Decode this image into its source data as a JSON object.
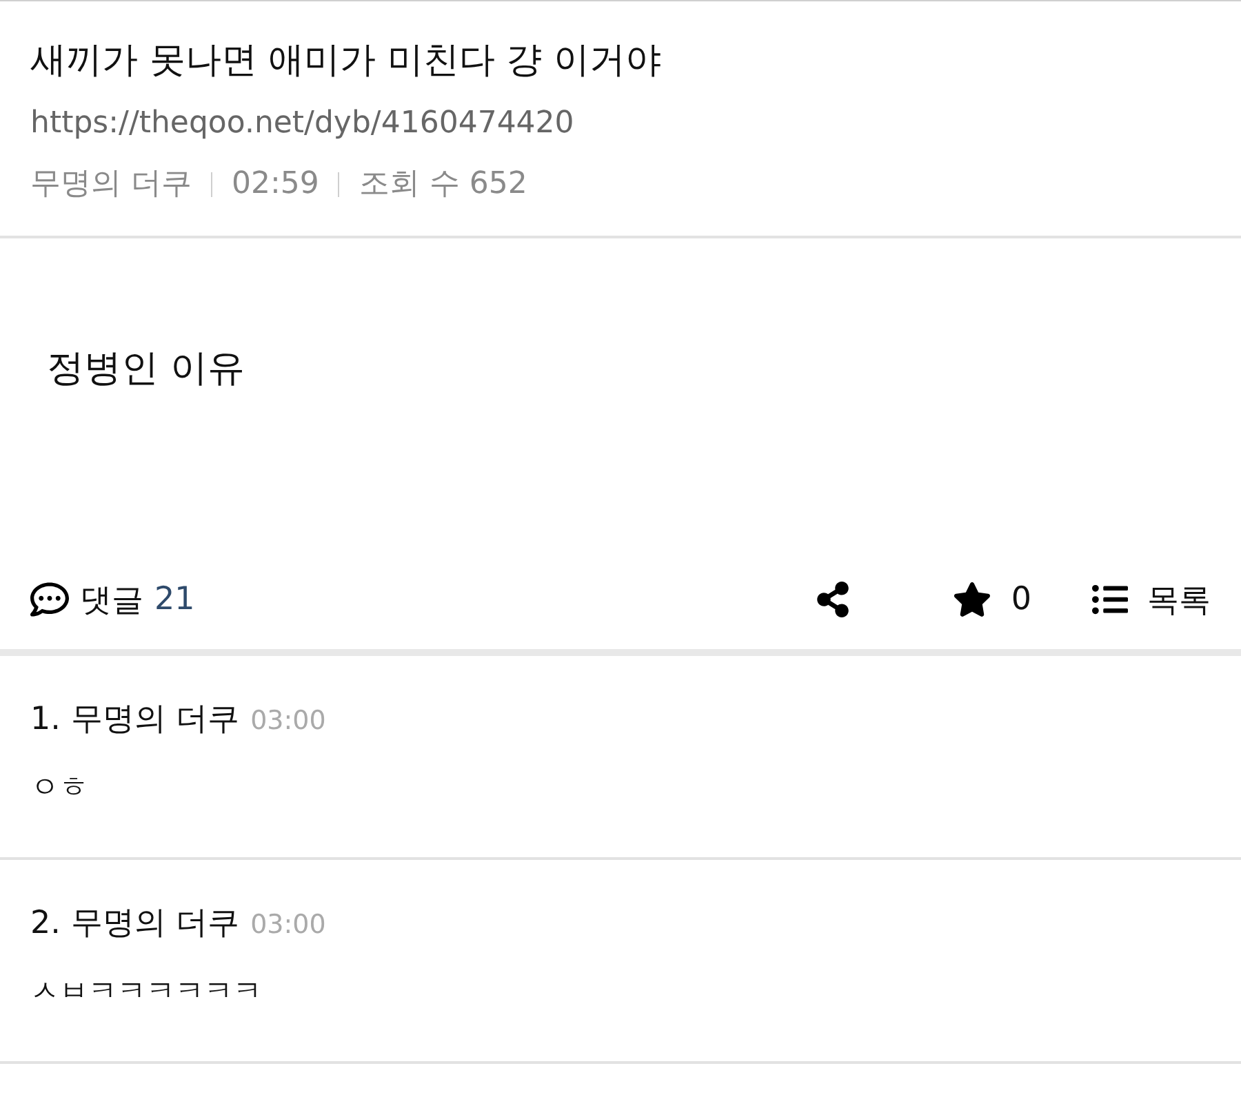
{
  "post": {
    "title": "새끼가 못나면 애미가 미친다 걍 이거야",
    "url": "https://theqoo.net/dyb/4160474420",
    "author": "무명의 더쿠",
    "time": "02:59",
    "views_label": "조회 수",
    "views": "652",
    "body": "정병인 이유"
  },
  "actions": {
    "comments_label": "댓글",
    "comments_count": "21",
    "stars": "0",
    "list_label": "목록"
  },
  "comments": [
    {
      "number": "1.",
      "author": "무명의 더쿠",
      "time": "03:00",
      "text": "ㅇㅎ"
    },
    {
      "number": "2.",
      "author": "무명의 더쿠",
      "time": "03:00",
      "text": "ㅅㅂㅋㅋㅋㅋㅋㅋ"
    }
  ]
}
